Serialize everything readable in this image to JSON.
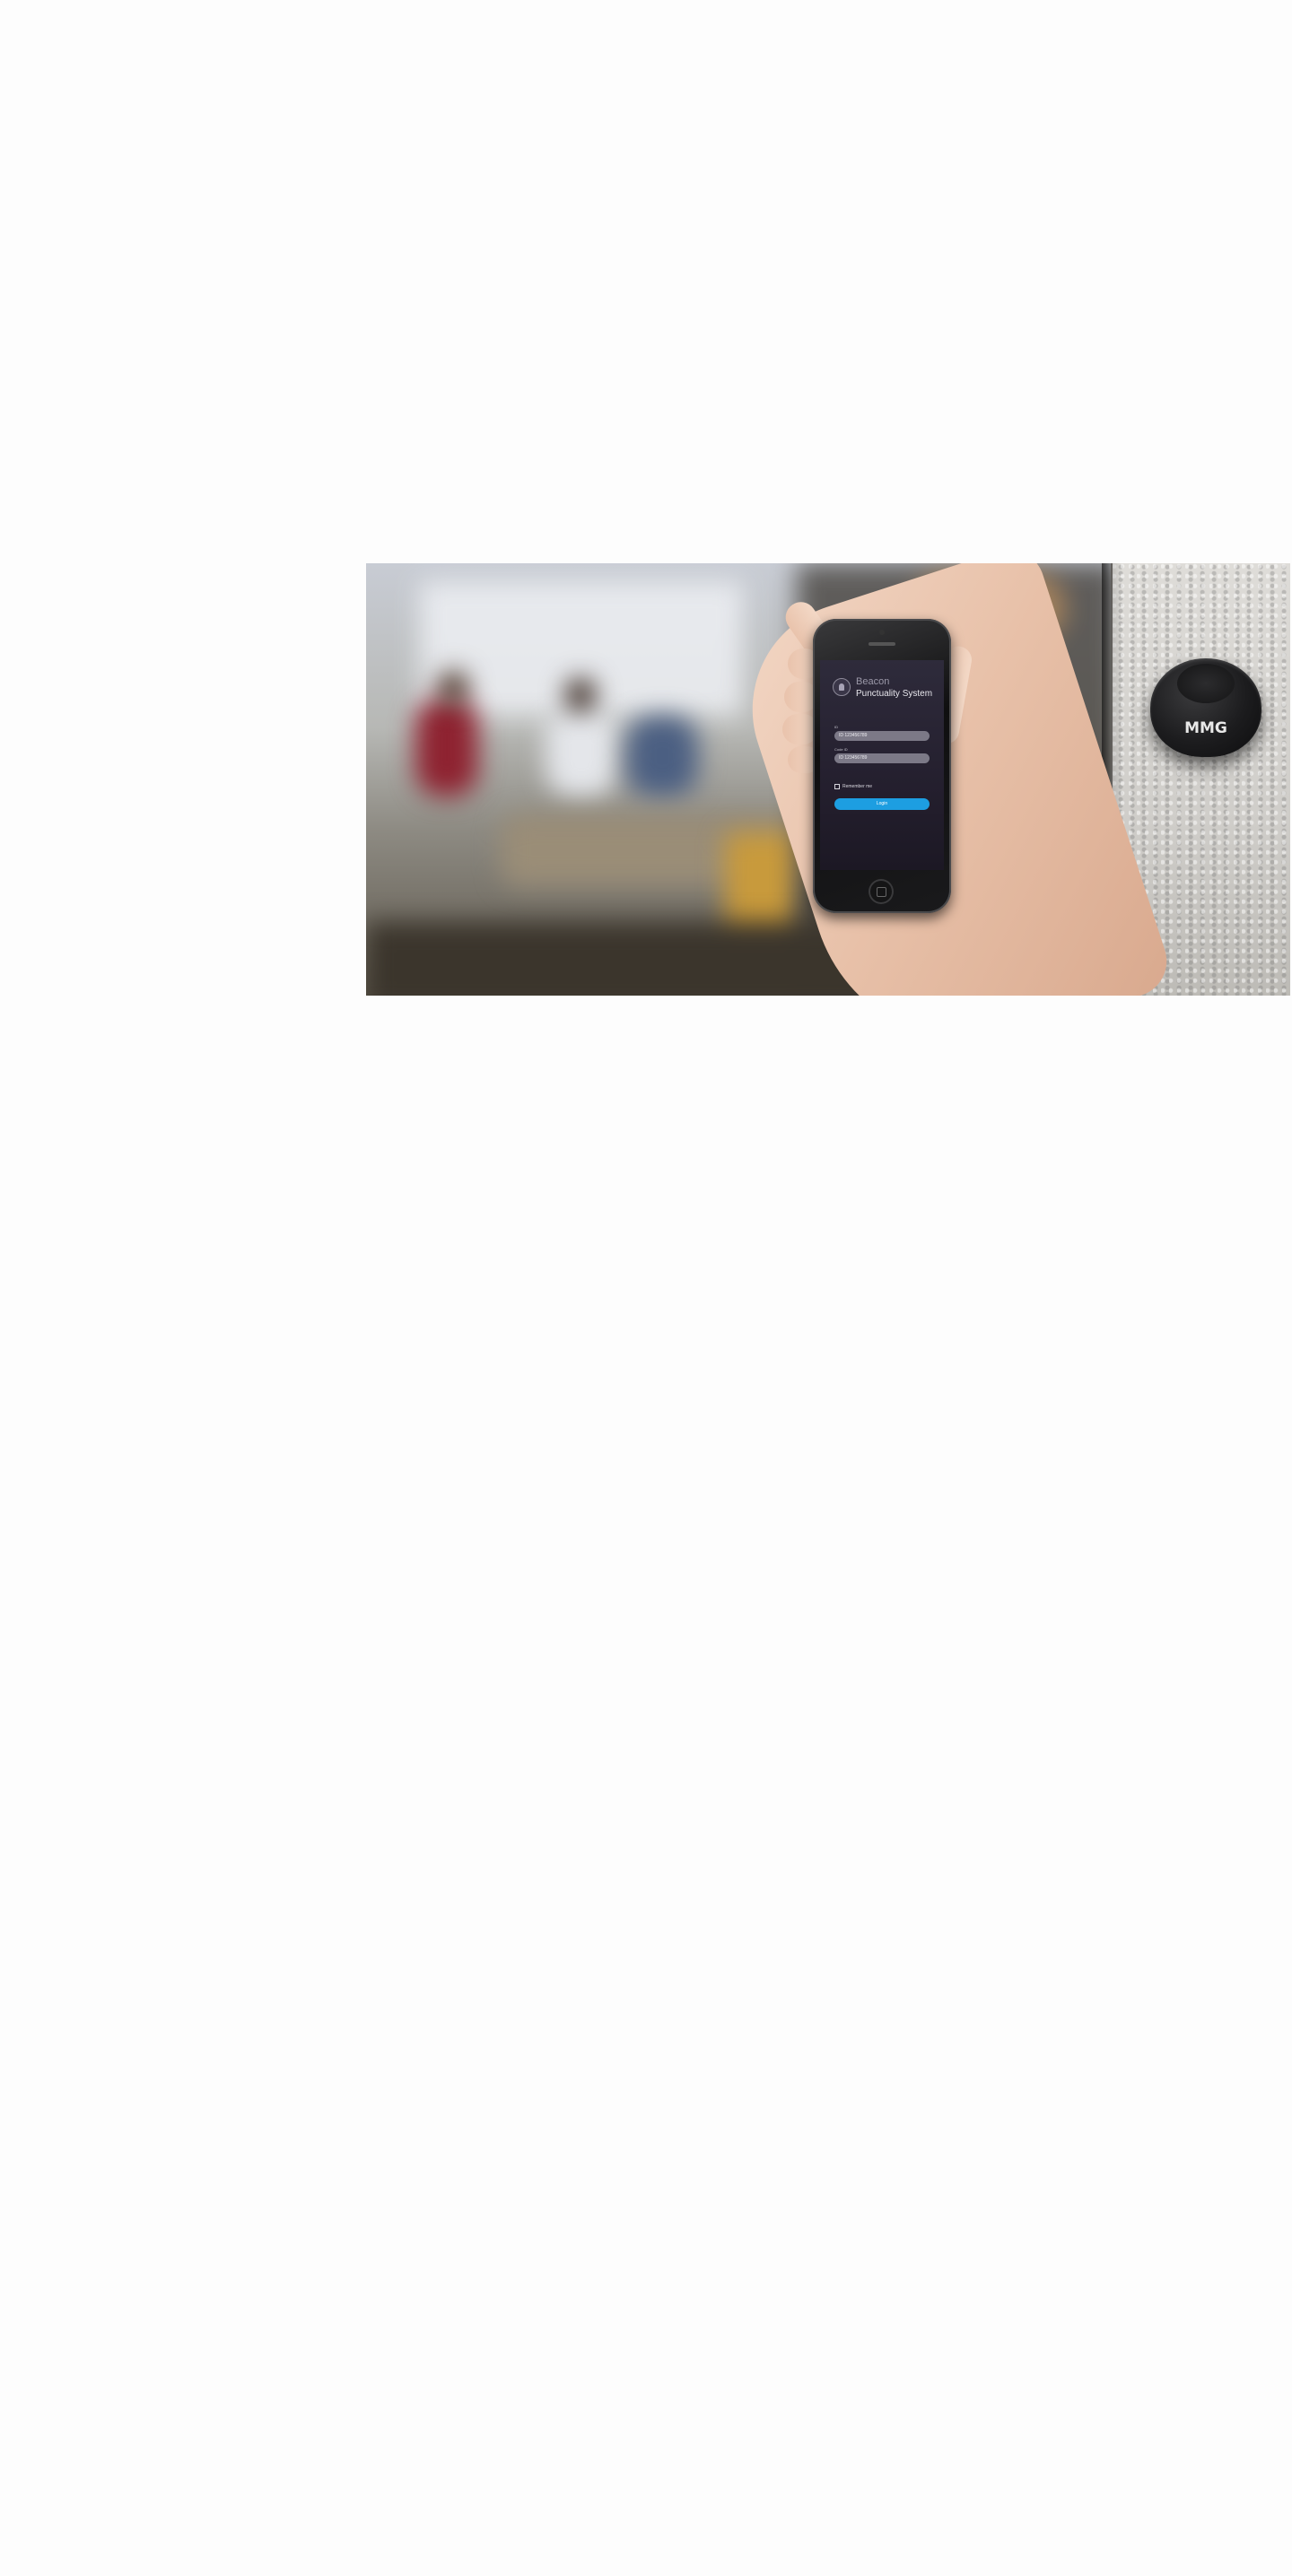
{
  "hero": {
    "phone_app": {
      "status": {
        "carrier": "",
        "time": "",
        "battery": ""
      },
      "title_line1": "Beacon",
      "title_line2": "Punctuality System",
      "id_label": "ID",
      "id_value": "ID 123456789",
      "code_label": "Code ID",
      "code_value": "ID 123456789",
      "remember_label": "Remember me",
      "login_label": "Login",
      "footer_note": ""
    },
    "beacon_logo": "MMG",
    "colors": {
      "login_button": "#1d9ee1",
      "screen_bg": "#2e2b3b",
      "page_bg": "#fdfdfd"
    },
    "icons": [
      "app-logo-icon",
      "checkbox-icon",
      "home-button-icon"
    ]
  }
}
